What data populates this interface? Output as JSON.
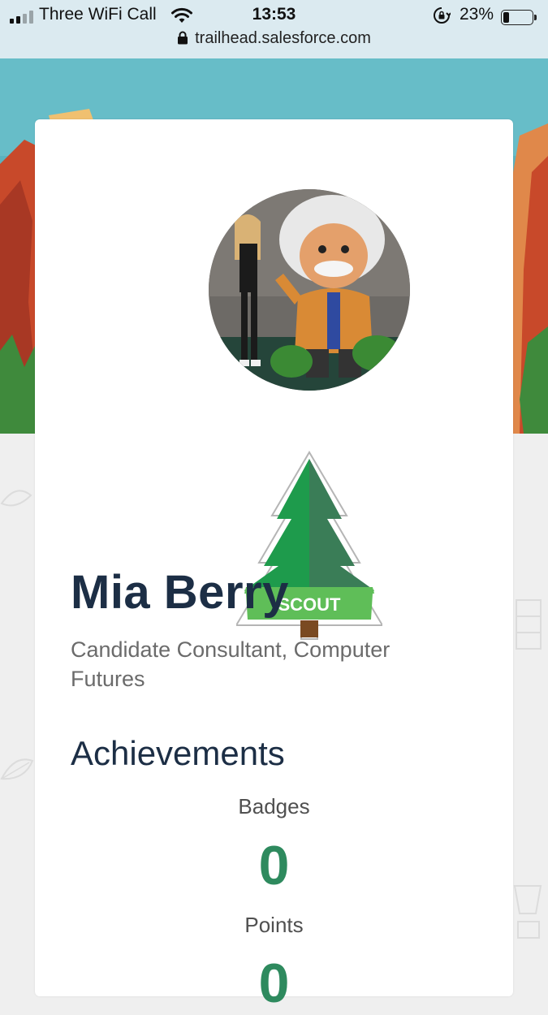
{
  "status_bar": {
    "carrier": "Three WiFi Call",
    "time": "13:53",
    "battery_percent": "23%",
    "battery_level": 0.23,
    "signal_bars_filled": 2,
    "signal_bars_total": 4,
    "icons": [
      "signal-icon",
      "wifi-icon",
      "rotation-lock-icon",
      "battery-icon"
    ]
  },
  "browser": {
    "url": "trailhead.salesforce.com",
    "icon": "lock-icon"
  },
  "profile": {
    "name": "Mia Berry",
    "title": "Candidate Consultant, Computer Futures",
    "rank": {
      "label": "SCOUT",
      "icon": "tree-icon"
    }
  },
  "achievements": {
    "heading": "Achievements",
    "badges_label": "Badges",
    "badges_value": "0",
    "points_label": "Points",
    "points_value": "0"
  },
  "colors": {
    "statusbar_bg": "#dbeaf0",
    "sky": "#5ab3c0",
    "rock": "#c8492a",
    "tree_green": "#1e9b4c",
    "tree_dark": "#3a7d57",
    "scout_band": "#5fbe58",
    "name_text": "#1c2e45",
    "stat_value": "#2e8a5e",
    "page_bg": "#efefef"
  }
}
